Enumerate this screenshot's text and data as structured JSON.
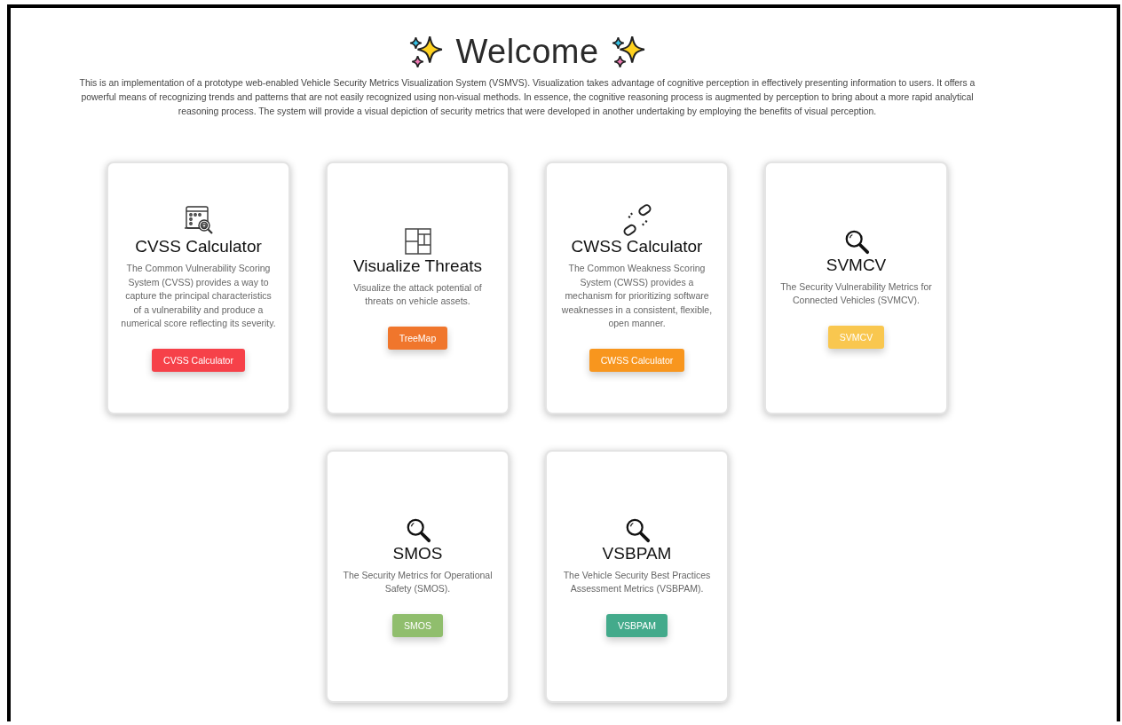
{
  "header": {
    "title": "Welcome",
    "intro": "This is an implementation of a prototype web-enabled Vehicle Security Metrics Visualization System (VSMVS). Visualization takes advantage of cognitive perception in effectively presenting information to users. It offers a powerful means of recognizing trends and patterns that are not easily recognized using non-visual methods. In essence, the cognitive reasoning process is augmented by perception to bring about a more rapid analytical reasoning process. The system will provide a visual depiction of security metrics that were developed in another undertaking by employing the benefits of visual perception."
  },
  "cards": [
    {
      "kind": "calculator",
      "title": "CVSS Calculator",
      "description": "The Common Vulnerability Scoring System (CVSS) provides a way to capture the principal characteristics of a vulnerability and produce a numerical score reflecting its severity.",
      "button": "CVSS Calculator",
      "color": "#f64149"
    },
    {
      "kind": "treemap",
      "title": "Visualize Threats",
      "description": "Visualize the attack potential of threats on vehicle assets.",
      "button": "TreeMap",
      "color": "#f0762c"
    },
    {
      "kind": "broken-link",
      "title": "CWSS Calculator",
      "description": "The Common Weakness Scoring System (CWSS) provides a mechanism for prioritizing software weaknesses in a consistent, flexible, open manner.",
      "button": "CWSS Calculator",
      "color": "#f8961e"
    },
    {
      "kind": "search",
      "title": "SVMCV",
      "description": "The Security Vulnerability Metrics for Connected Vehicles (SVMCV).",
      "button": "SVMCV",
      "color": "#f9c74f"
    },
    {
      "kind": "search",
      "title": "SMOS",
      "description": "The Security Metrics for Operational Safety (SMOS).",
      "button": "SMOS",
      "color": "#90be6d"
    },
    {
      "kind": "search",
      "title": "VSBPAM",
      "description": "The Vehicle Security Best Practices Assessment Metrics (VSBPAM).",
      "button": "VSBPAM",
      "color": "#43aa8b"
    }
  ]
}
